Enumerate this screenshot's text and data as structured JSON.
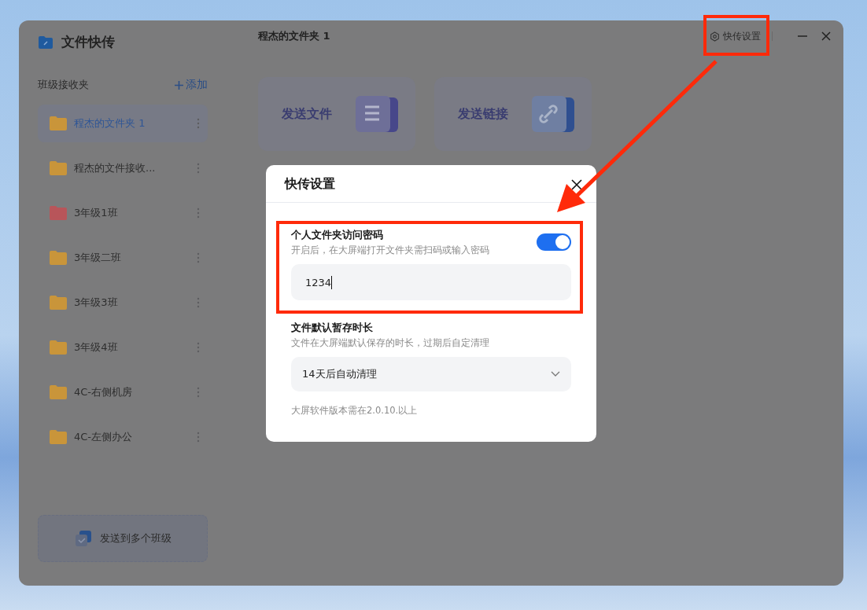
{
  "app": {
    "title": "文件快传"
  },
  "sidebar": {
    "heading": "班级接收夹",
    "add_label": "添加",
    "items": [
      {
        "label": "程杰的文件夹 1",
        "selected": true,
        "color": "#c9953a"
      },
      {
        "label": "程杰的文件接收...",
        "selected": false,
        "color": "#c9953a"
      },
      {
        "label": "3年级1班",
        "selected": false,
        "color": "#b8555a"
      },
      {
        "label": "3年级二班",
        "selected": false,
        "color": "#c9953a"
      },
      {
        "label": "3年级3班",
        "selected": false,
        "color": "#c9953a"
      },
      {
        "label": "3年级4班",
        "selected": false,
        "color": "#c9953a"
      },
      {
        "label": "4C-右侧机房",
        "selected": false,
        "color": "#c9953a"
      },
      {
        "label": "4C-左侧办公",
        "selected": false,
        "color": "#c9953a"
      }
    ],
    "send_multi": "发送到多个班级"
  },
  "header": {
    "title": "程杰的文件夹 1",
    "settings_label": "快传设置"
  },
  "actions": [
    {
      "label": "发送文件",
      "kind": "file"
    },
    {
      "label": "发送链接",
      "kind": "link"
    }
  ],
  "dialog": {
    "title": "快传设置",
    "password": {
      "label": "个人文件夹访问密码",
      "hint": "开启后，在大屏端打开文件夹需扫码或输入密码",
      "on": true,
      "value": "1234"
    },
    "retention": {
      "label": "文件默认暂存时长",
      "hint": "文件在大屏端默认保存的时长，过期后自定清理",
      "value": "14天后自动清理"
    },
    "note": "大屏软件版本需在2.0.10.以上"
  }
}
